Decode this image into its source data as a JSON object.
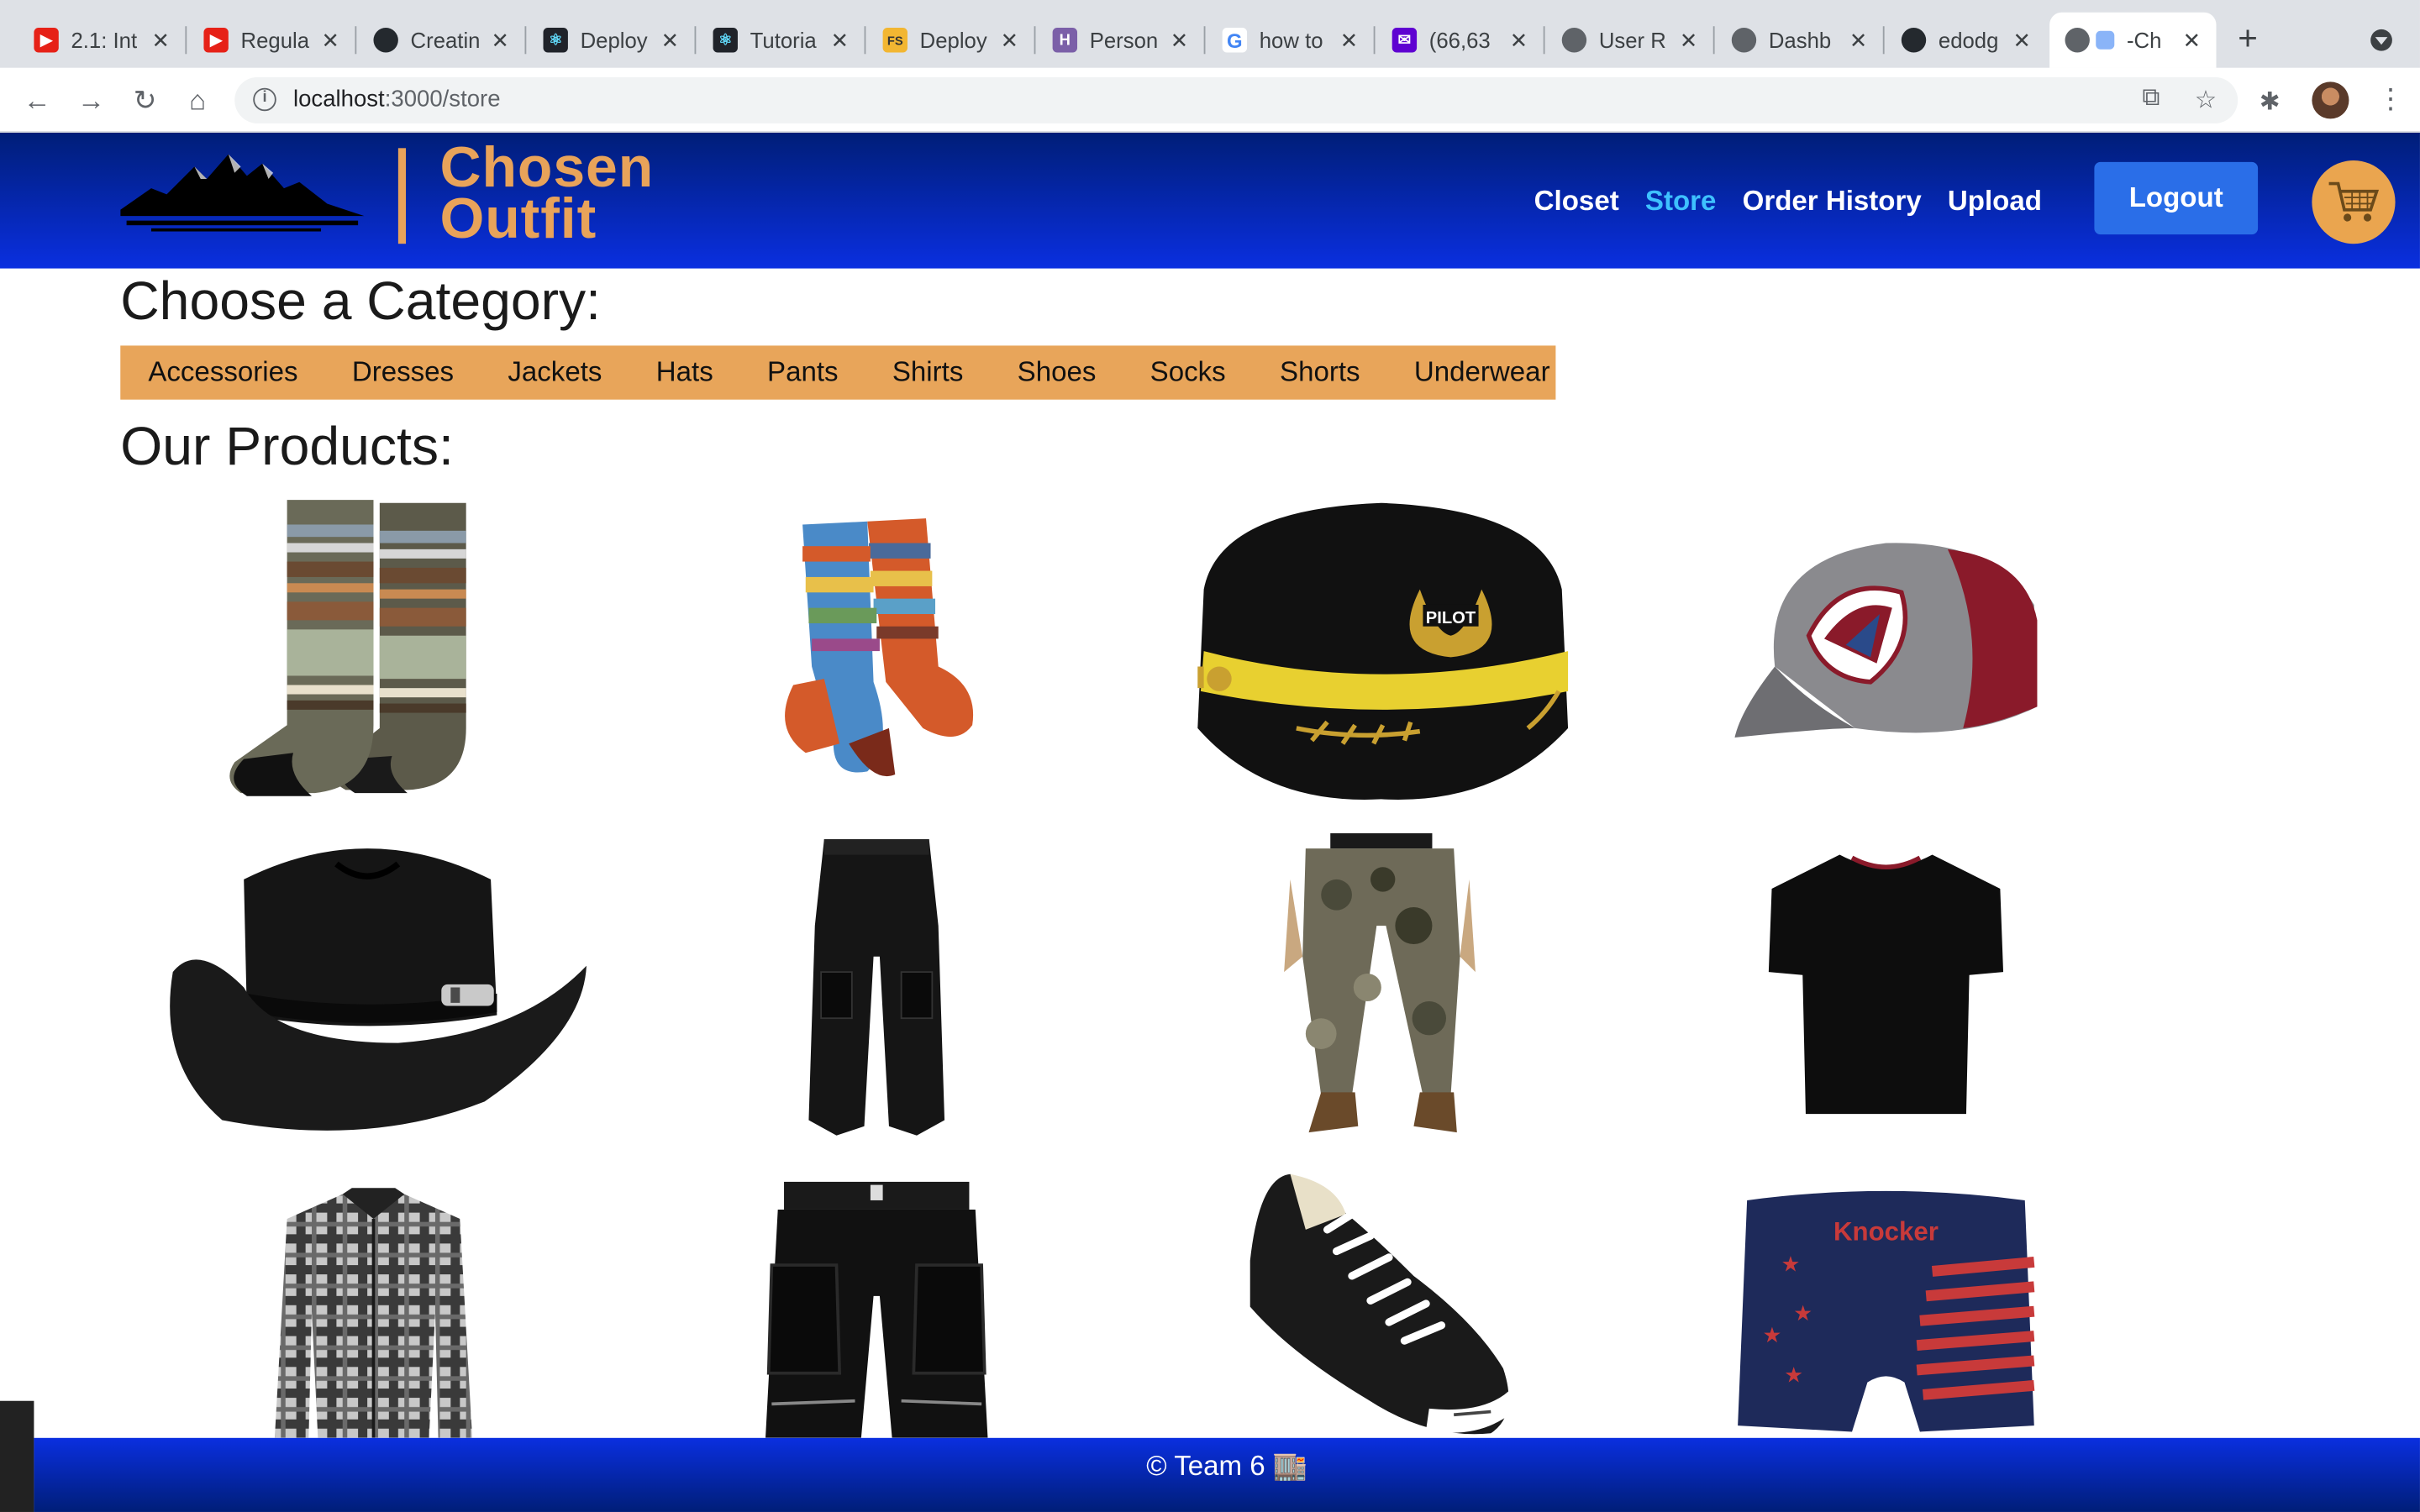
{
  "browser": {
    "tabs": [
      {
        "title": "2.1: Int",
        "icon": "youtube-icon"
      },
      {
        "title": "Regula",
        "icon": "youtube-icon"
      },
      {
        "title": "Creatin",
        "icon": "github-icon"
      },
      {
        "title": "Deploy",
        "icon": "react-icon"
      },
      {
        "title": "Tutoria",
        "icon": "react-icon"
      },
      {
        "title": "Deploy",
        "icon": "fullstack-icon"
      },
      {
        "title": "Person",
        "icon": "heroku-icon"
      },
      {
        "title": "how to",
        "icon": "google-icon"
      },
      {
        "title": "(66,63",
        "icon": "mail-icon"
      },
      {
        "title": "User R",
        "icon": "globe-icon"
      },
      {
        "title": "Dashb",
        "icon": "globe-icon"
      },
      {
        "title": "edodg",
        "icon": "github-icon"
      },
      {
        "title": "-Ch",
        "icon": "globe-icon",
        "active": true
      }
    ],
    "url_host": "localhost",
    "url_path": ":3000/store"
  },
  "site": {
    "brand_line1": "Chosen",
    "brand_line2": "Outfit",
    "nav": {
      "closet": "Closet",
      "store": "Store",
      "order_history": "Order History",
      "upload": "Upload"
    },
    "logout": "Logout",
    "brand_color": "#e8a55a",
    "header_color": "#0a2fe0",
    "active_link_color": "#3ec1ff"
  },
  "store": {
    "category_heading": "Choose a Category:",
    "categories": [
      "Accessories",
      "Dresses",
      "Jackets",
      "Hats",
      "Pants",
      "Shirts",
      "Shoes",
      "Socks",
      "Shorts",
      "Underwear"
    ],
    "products_heading": "Our Products:",
    "products": [
      {
        "name": "striped-socks"
      },
      {
        "name": "patterned-socks"
      },
      {
        "name": "pilot-cap"
      },
      {
        "name": "hockey-cap"
      },
      {
        "name": "cowboy-hat"
      },
      {
        "name": "black-pants"
      },
      {
        "name": "camo-cargo-pants"
      },
      {
        "name": "black-tshirt"
      },
      {
        "name": "plaid-shirt"
      },
      {
        "name": "black-cargo-shorts"
      },
      {
        "name": "black-sneaker"
      },
      {
        "name": "knocker-boxer-briefs",
        "label": "Knocker"
      }
    ]
  },
  "footer": {
    "text": "© Team 6 🏬"
  }
}
